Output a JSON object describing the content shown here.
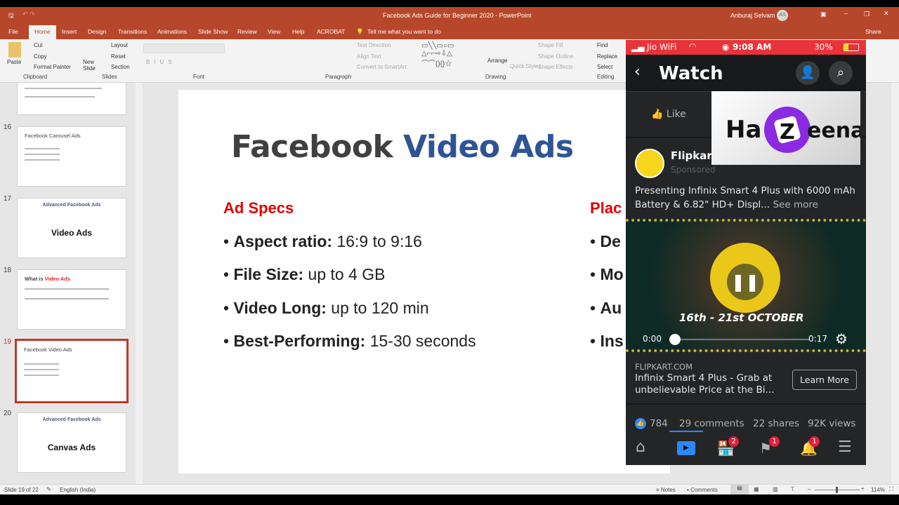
{
  "window": {
    "title": "Facebook Ads Guide for Beginner 2020  -  PowerPoint",
    "user": "Anburaj Selvam",
    "user_initials": "AS",
    "share": "Share"
  },
  "ribbon_tabs": [
    "File",
    "Home",
    "Insert",
    "Design",
    "Transitions",
    "Animations",
    "Slide Show",
    "Review",
    "View",
    "Help",
    "ACROBAT",
    "Tell me what you want to do"
  ],
  "ribbon": {
    "clipboard": {
      "paste": "Paste",
      "cut": "Cut",
      "copy": "Copy",
      "format_painter": "Format Painter",
      "label": "Clipboard"
    },
    "slides": {
      "new_slide": "New Slide",
      "layout": "Layout",
      "reset": "Reset",
      "section": "Section",
      "label": "Slides"
    },
    "font": {
      "label": "Font"
    },
    "paragraph": {
      "text_direction": "Text Direction",
      "align_text": "Align Text",
      "convert": "Convert to SmartArt",
      "label": "Paragraph"
    },
    "drawing": {
      "arrange": "Arrange",
      "quick_styles": "Quick Styles",
      "shape_fill": "Shape Fill",
      "shape_outline": "Shape Outline",
      "shape_effects": "Shape Effects",
      "label": "Drawing"
    },
    "editing": {
      "find": "Find",
      "replace": "Replace",
      "select": "Select",
      "label": "Editing"
    }
  },
  "thumbnails": [
    {
      "num": "16",
      "title": "Facebook Carousel Ads"
    },
    {
      "num": "17",
      "header": "Advanced Facebook Ads",
      "title": "Video Ads"
    },
    {
      "num": "18",
      "title": "What is",
      "title_accent": "Video Ads"
    },
    {
      "num": "19",
      "title": "Facebook Video Ads",
      "selected": true
    },
    {
      "num": "20",
      "header": "Advanced Facebook Ads",
      "title": "Canvas Ads"
    }
  ],
  "slide": {
    "title_a": "Facebook",
    "title_b": "Video Ads",
    "specs_heading": "Ad Specs",
    "specs": [
      {
        "label": "Aspect ratio:",
        "value": "16:9 to 9:16"
      },
      {
        "label": "File Size:",
        "value": "up to 4 GB"
      },
      {
        "label": "Video Long:",
        "value": "up to 120 min"
      },
      {
        "label": "Best-Performing:",
        "value": "15-30 seconds"
      }
    ],
    "placements_heading": "Plac",
    "placements": [
      "De",
      "Mo",
      "Au",
      "Ins"
    ]
  },
  "phone": {
    "carrier": "Jio WiFi",
    "time": "9:08 AM",
    "battery": "30%",
    "header": "Watch",
    "like": "Like",
    "page_name": "Flipkart",
    "sponsored": "Sponsored",
    "post_text": "Presenting Infinix Smart 4 Plus with 6000 mAh Battery & 6.82\" HD+ Displ...",
    "see_more": "See more",
    "video_banner": "16th - 21st OCTOBER",
    "time_current": "0:00",
    "time_total": "0:17",
    "progress": 0,
    "link_domain": "FLIPKART.COM",
    "link_title": "Infinix Smart 4 Plus - Grab at unbelievable Price at the Bi...",
    "cta": "Learn More",
    "likes": "784",
    "comments": "29 comments",
    "shares": "22 shares",
    "views": "92K views",
    "nav_badges": {
      "marketplace": "2",
      "pages": "1",
      "notifications": "1"
    },
    "watermark": "HaZeena"
  },
  "status": {
    "slide_info": "Slide 19 of 22",
    "language": "English (India)",
    "notes": "Notes",
    "comments": "Comments",
    "zoom": "114%"
  }
}
